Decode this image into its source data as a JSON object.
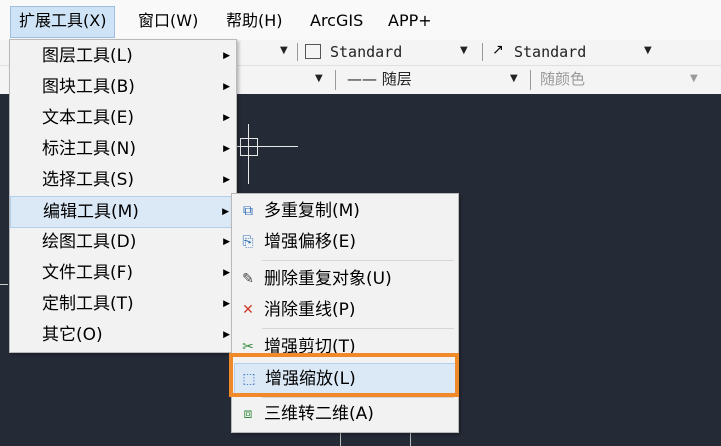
{
  "menubar": {
    "items": [
      {
        "label": "扩展工具(X)"
      },
      {
        "label": "窗口(W)"
      },
      {
        "label": "帮助(H)"
      },
      {
        "label": "ArcGIS"
      },
      {
        "label": "APP+"
      }
    ]
  },
  "toolbar": {
    "style1": "Standard",
    "style2": "Standard",
    "linetype": "—— 随层",
    "color": "随颜色"
  },
  "extension_menu": {
    "items": [
      {
        "label": "图层工具(L)"
      },
      {
        "label": "图块工具(B)"
      },
      {
        "label": "文本工具(E)"
      },
      {
        "label": "标注工具(N)"
      },
      {
        "label": "选择工具(S)"
      },
      {
        "label": "编辑工具(M)"
      },
      {
        "label": "绘图工具(D)"
      },
      {
        "label": "文件工具(F)"
      },
      {
        "label": "定制工具(T)"
      },
      {
        "label": "其它(O)"
      }
    ]
  },
  "edit_submenu": {
    "items": [
      {
        "label": "多重复制(M)",
        "icon": "multi-copy-icon"
      },
      {
        "label": "增强偏移(E)",
        "icon": "offset-icon"
      },
      {
        "label": "删除重复对象(U)",
        "icon": "brush-icon"
      },
      {
        "label": "消除重线(P)",
        "icon": "x-icon"
      },
      {
        "label": "增强剪切(T)",
        "icon": "scissors-icon"
      },
      {
        "label": "增强缩放(L)",
        "icon": "scale-icon"
      },
      {
        "label": "三维转二维(A)",
        "icon": "3d-to-2d-icon"
      }
    ]
  },
  "colors": {
    "canvas": "#252b36",
    "highlight_border": "#f0892a",
    "hover": "#dbe9f7"
  }
}
